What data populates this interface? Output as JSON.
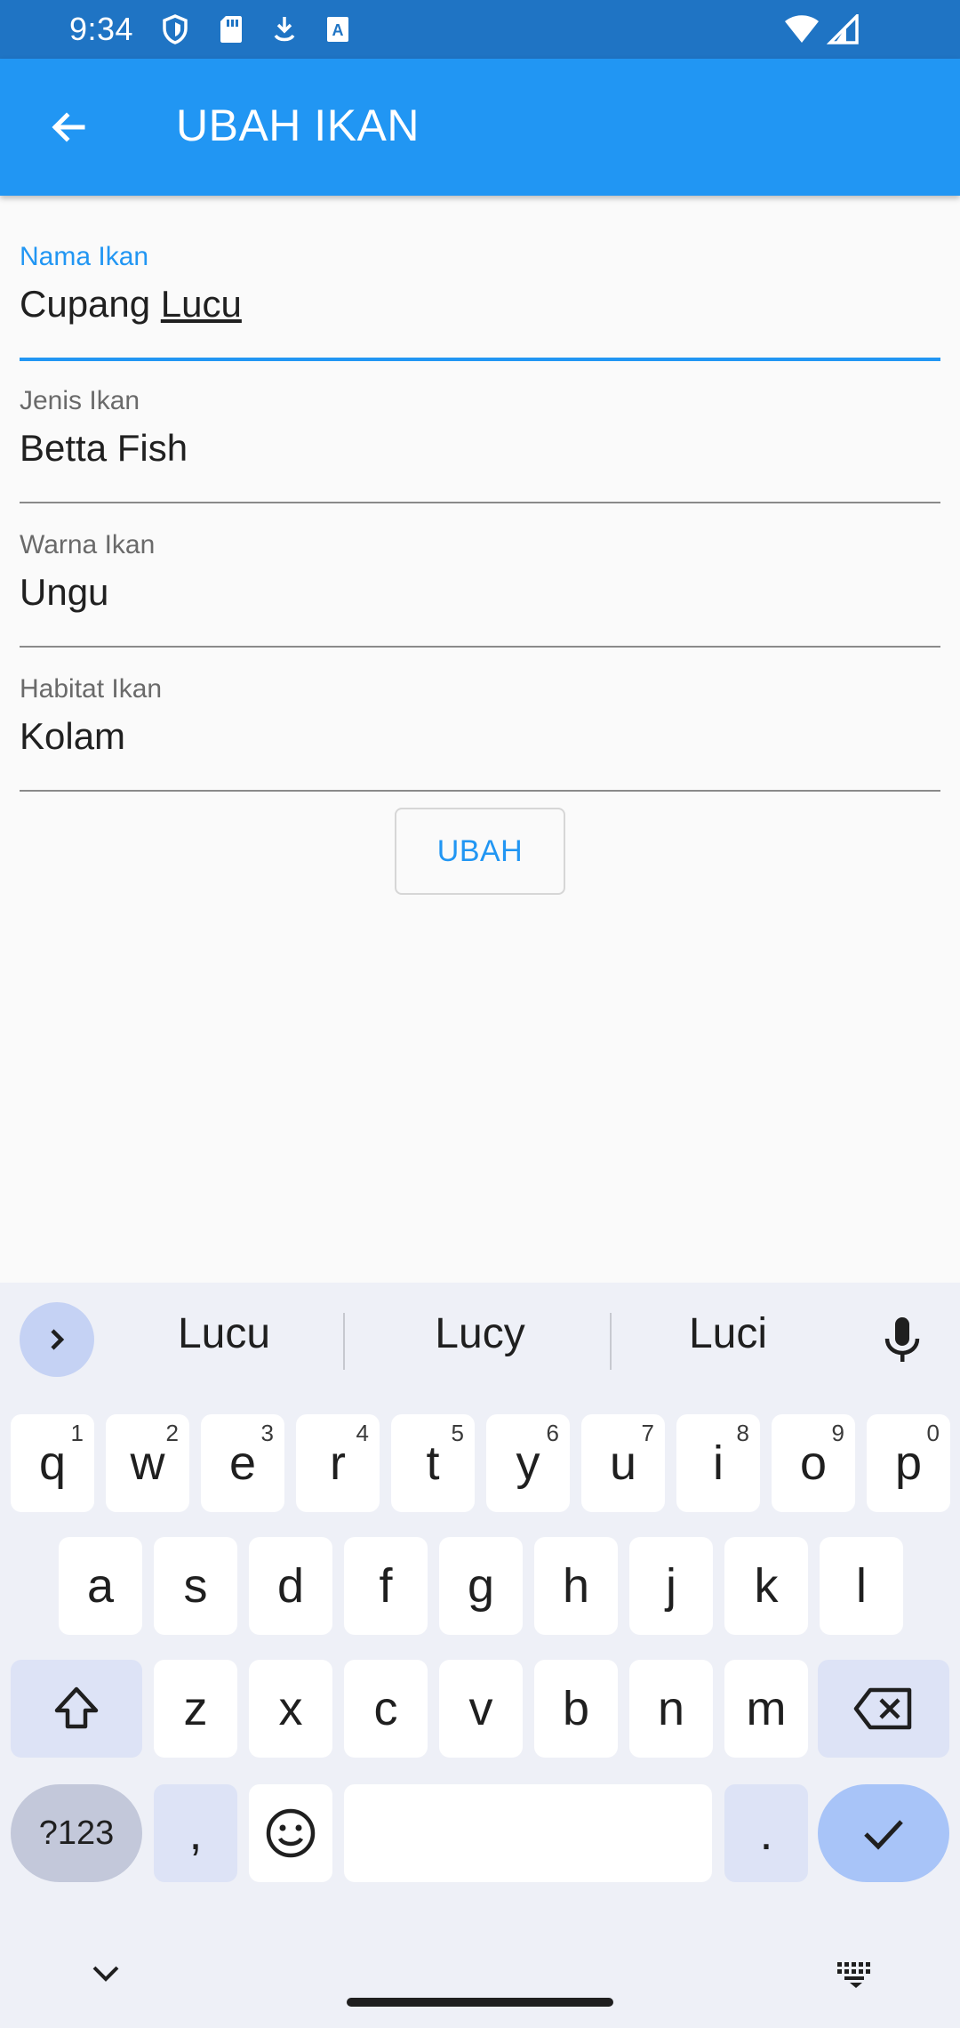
{
  "status_bar": {
    "time": "9:34",
    "icons": [
      "shield-icon",
      "sd-card-icon",
      "download-icon",
      "font-icon",
      "wifi-icon",
      "signal-icon"
    ]
  },
  "app_bar": {
    "title": "UBAH IKAN",
    "back_icon": "arrow-left-icon",
    "color": "#2196f3"
  },
  "form": {
    "fields": [
      {
        "label": "Nama Ikan",
        "value_plain": "Cupang ",
        "value_underlined": "Lucu",
        "focused": true
      },
      {
        "label": "Jenis Ikan",
        "value": "Betta Fish"
      },
      {
        "label": "Warna Ikan",
        "value": "Ungu"
      },
      {
        "label": "Habitat Ikan",
        "value": "Kolam"
      }
    ],
    "submit_label": "UBAH"
  },
  "keyboard": {
    "suggestions": [
      "Lucu",
      "Lucy",
      "Luci"
    ],
    "row1": [
      {
        "key": "q",
        "num": "1"
      },
      {
        "key": "w",
        "num": "2"
      },
      {
        "key": "e",
        "num": "3"
      },
      {
        "key": "r",
        "num": "4"
      },
      {
        "key": "t",
        "num": "5"
      },
      {
        "key": "y",
        "num": "6"
      },
      {
        "key": "u",
        "num": "7"
      },
      {
        "key": "i",
        "num": "8"
      },
      {
        "key": "o",
        "num": "9"
      },
      {
        "key": "p",
        "num": "0"
      }
    ],
    "row2": [
      "a",
      "s",
      "d",
      "f",
      "g",
      "h",
      "j",
      "k",
      "l"
    ],
    "row3": [
      "z",
      "x",
      "c",
      "v",
      "b",
      "n",
      "m"
    ],
    "symbols_label": "?123",
    "comma_label": ",",
    "period_label": "."
  }
}
